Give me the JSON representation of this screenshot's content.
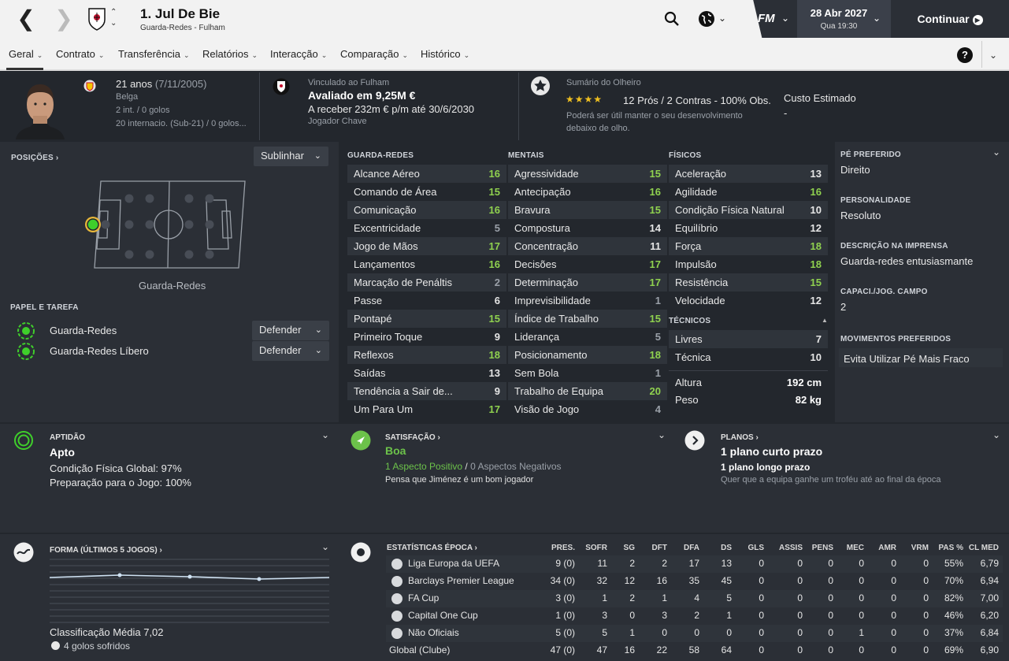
{
  "topbar": {
    "back": "❮",
    "forward": "❯",
    "up": "⌃",
    "down": "⌄",
    "player_name": "1. Jul De Bie",
    "player_sub": "Guarda-Redes - Fulham",
    "fm": "FM",
    "date": "28 Abr 2027",
    "date_sub": "Qua 19:30",
    "continue": "Continuar"
  },
  "tabs": [
    {
      "label": "Geral"
    },
    {
      "label": "Contrato"
    },
    {
      "label": "Transferência"
    },
    {
      "label": "Relatórios"
    },
    {
      "label": "Interacção"
    },
    {
      "label": "Comparação"
    },
    {
      "label": "Histórico"
    }
  ],
  "help": "?",
  "profile": {
    "age": "21 anos",
    "dob": "(7/11/2005)",
    "nation": "Belga",
    "caps": "2 int. / 0 golos",
    "u21": "20 internacio. (Sub-21) / 0 golos...",
    "contract_label": "Vinculado ao Fulham",
    "value": "Avaliado em 9,25M €",
    "wage": "A receber 232m € p/m até 30/6/2030",
    "status": "Jogador Chave",
    "scout_label": "Sumário do Olheiro",
    "stars": "★★★★",
    "scout_summary": "12 Prós / 2 Contras - 100% Obs.",
    "scout_note1": "Poderá ser útil manter o seu desenvolvimento",
    "scout_note2": "debaixo de olho.",
    "cost_label": "Custo Estimado",
    "cost_value": "-"
  },
  "positions": {
    "label": "POSIÇÕES ›",
    "dropdown": "Sublinhar",
    "caption": "Guarda-Redes",
    "role_label": "PAPEL E TAREFA",
    "roles": [
      {
        "name": "Guarda-Redes",
        "duty": "Defender"
      },
      {
        "name": "Guarda-Redes Líbero",
        "duty": "Defender"
      }
    ]
  },
  "attributes": {
    "gk_label": "GUARDA-REDES",
    "mental_label": "MENTAIS",
    "physical_label": "FÍSICOS",
    "technical_label": "TÉCNICOS",
    "gk": [
      [
        "Alcance Aéreo",
        "16"
      ],
      [
        "Comando de Área",
        "15"
      ],
      [
        "Comunicação",
        "16"
      ],
      [
        "Excentricidade",
        "5"
      ],
      [
        "Jogo de Mãos",
        "17"
      ],
      [
        "Lançamentos",
        "16"
      ],
      [
        "Marcação de Penáltis",
        "2"
      ],
      [
        "Passe",
        "6"
      ],
      [
        "Pontapé",
        "15"
      ],
      [
        "Primeiro Toque",
        "9"
      ],
      [
        "Reflexos",
        "18"
      ],
      [
        "Saídas",
        "13"
      ],
      [
        "Tendência a Sair de...",
        "9"
      ],
      [
        "Um Para Um",
        "17"
      ]
    ],
    "mental": [
      [
        "Agressividade",
        "15"
      ],
      [
        "Antecipação",
        "16"
      ],
      [
        "Bravura",
        "15"
      ],
      [
        "Compostura",
        "14"
      ],
      [
        "Concentração",
        "11"
      ],
      [
        "Decisões",
        "17"
      ],
      [
        "Determinação",
        "17"
      ],
      [
        "Imprevisibilidade",
        "1"
      ],
      [
        "Índice de Trabalho",
        "15"
      ],
      [
        "Liderança",
        "5"
      ],
      [
        "Posicionamento",
        "18"
      ],
      [
        "Sem Bola",
        "1"
      ],
      [
        "Trabalho de Equipa",
        "20"
      ],
      [
        "Visão de Jogo",
        "4"
      ]
    ],
    "physical": [
      [
        "Aceleração",
        "13"
      ],
      [
        "Agilidade",
        "16"
      ],
      [
        "Condição Física Natural",
        "10"
      ],
      [
        "Equilíbrio",
        "12"
      ],
      [
        "Força",
        "18"
      ],
      [
        "Impulsão",
        "18"
      ],
      [
        "Resistência",
        "15"
      ],
      [
        "Velocidade",
        "12"
      ]
    ],
    "technical": [
      [
        "Livres",
        "7"
      ],
      [
        "Técnica",
        "10"
      ]
    ],
    "height_label": "Altura",
    "height": "192 cm",
    "weight_label": "Peso",
    "weight": "82 kg"
  },
  "side": {
    "foot_label": "PÉ PREFERIDO",
    "foot": "Direito",
    "pers_label": "PERSONALIDADE",
    "pers": "Resoluto",
    "press_label": "DESCRIÇÃO NA IMPRENSA",
    "press": "Guarda-redes entusiasmante",
    "ability_label": "CAPACI./JOG. CAMPO",
    "ability": "2",
    "moves_label": "MOVIMENTOS PREFERIDOS",
    "moves": "Evita Utilizar Pé Mais Fraco"
  },
  "fitness": {
    "label": "APTIDÃO",
    "status": "Apto",
    "line1": "Condição Física Global: 97%",
    "line2": "Preparação para o Jogo: 100%"
  },
  "happiness": {
    "label": "SATISFAÇÃO ›",
    "status": "Boa",
    "positive": "1 Aspecto Positivo",
    "sep": "/",
    "negative": "0 Aspectos Negativos",
    "note": "Pensa que Jiménez é um bom jogador"
  },
  "plans": {
    "label": "PLANOS ›",
    "short": "1 plano curto prazo",
    "long": "1 plano longo prazo",
    "note": "Quer que a equipa ganhe um troféu até ao final da época"
  },
  "form": {
    "label": "FORMA (ÚLTIMOS 5 JOGOS) ›",
    "avg": "Classificação Média 7,02",
    "goals": "4 golos sofridos"
  },
  "stats": {
    "label": "ESTATÍSTICAS ÉPOCA ›",
    "headers": [
      "PRES.",
      "SOFR",
      "SG",
      "DFT",
      "DFA",
      "DS",
      "GLS",
      "ASSIS",
      "PENS",
      "MEC",
      "AMR",
      "VRM",
      "PAS %",
      "CL MED"
    ],
    "rows": [
      {
        "comp": "Liga Europa da UEFA",
        "v": [
          "9 (0)",
          "11",
          "2",
          "2",
          "17",
          "13",
          "0",
          "0",
          "0",
          "0",
          "0",
          "0",
          "55%",
          "6,79"
        ]
      },
      {
        "comp": "Barclays Premier League",
        "v": [
          "34 (0)",
          "32",
          "12",
          "16",
          "35",
          "45",
          "0",
          "0",
          "0",
          "0",
          "0",
          "0",
          "70%",
          "6,94"
        ]
      },
      {
        "comp": "FA Cup",
        "v": [
          "3 (0)",
          "1",
          "2",
          "1",
          "4",
          "5",
          "0",
          "0",
          "0",
          "0",
          "0",
          "0",
          "82%",
          "7,00"
        ]
      },
      {
        "comp": "Capital One Cup",
        "v": [
          "1 (0)",
          "3",
          "0",
          "3",
          "2",
          "1",
          "0",
          "0",
          "0",
          "0",
          "0",
          "0",
          "46%",
          "6,20"
        ]
      },
      {
        "comp": "Não Oficiais",
        "v": [
          "5 (0)",
          "5",
          "1",
          "0",
          "0",
          "0",
          "0",
          "0",
          "0",
          "1",
          "0",
          "0",
          "37%",
          "6,84"
        ]
      },
      {
        "comp": "Global (Clube)",
        "v": [
          "47 (0)",
          "47",
          "16",
          "22",
          "58",
          "64",
          "0",
          "0",
          "0",
          "0",
          "0",
          "0",
          "69%",
          "6,90"
        ]
      }
    ]
  },
  "colors": {
    "high": "#8fd14f",
    "mid": "#e6e6e6",
    "low": "#9aa0a8",
    "accent": "#6cc24a"
  }
}
